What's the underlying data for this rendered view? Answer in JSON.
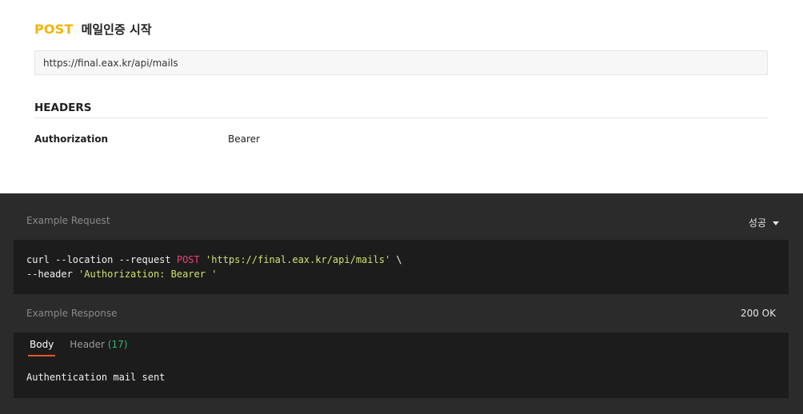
{
  "request": {
    "method": "POST",
    "name": "메일인증 시작",
    "url": "https://final.eax.kr/api/mails"
  },
  "headers": {
    "title": "HEADERS",
    "items": [
      {
        "key": "Authorization",
        "value": "Bearer"
      }
    ]
  },
  "example_request": {
    "label": "Example Request",
    "language_selected": "성공",
    "code": {
      "line1_prefix": "curl --location --request ",
      "line1_method": "POST",
      "line1_space": " ",
      "line1_url": "'https://final.eax.kr/api/mails'",
      "line1_suffix": " \\",
      "line2_prefix": "--header ",
      "line2_header": "'Authorization: Bearer '"
    }
  },
  "example_response": {
    "label": "Example Response",
    "status": "200 OK",
    "tabs": {
      "body": "Body",
      "header": "Header",
      "header_count": "(17)"
    },
    "body_text": "Authentication mail sent"
  },
  "colors": {
    "method_post": "#f4b400",
    "code_keyword": "#e8447a",
    "code_string": "#d0e36c",
    "tab_active_underline": "#e8562d",
    "tab_count": "#2dbb6b"
  }
}
